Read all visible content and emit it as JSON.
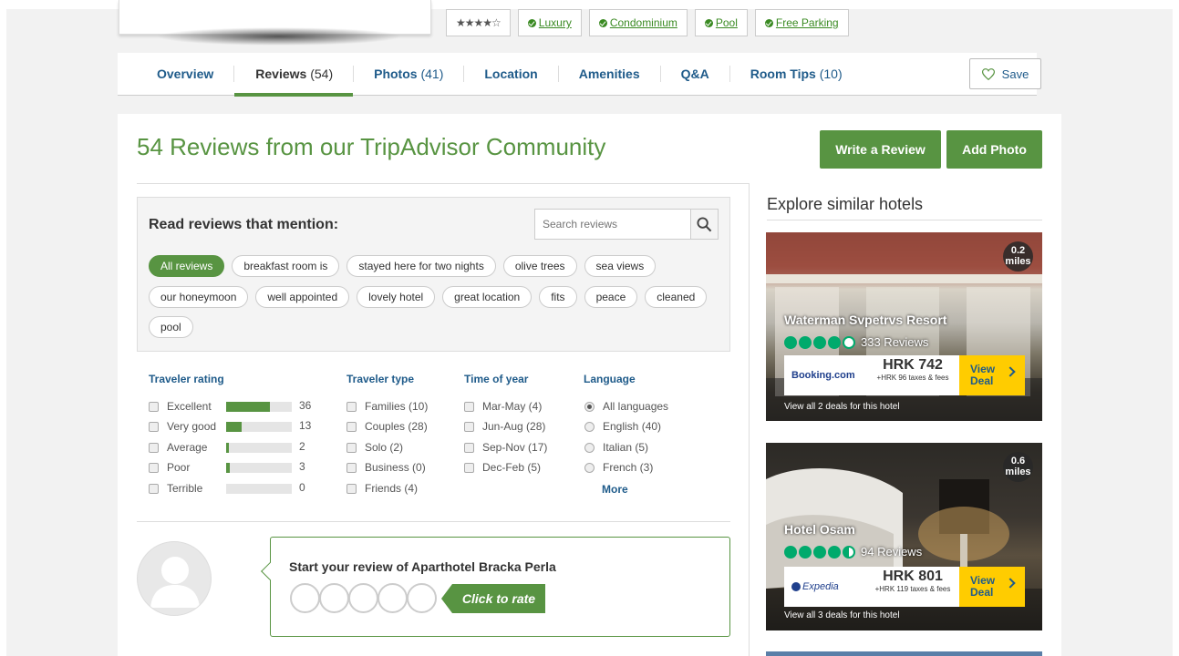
{
  "top": {
    "stars": "★★★★☆",
    "chips": [
      "Luxury",
      "Condominium",
      "Pool",
      "Free Parking"
    ]
  },
  "nav": {
    "tabs": [
      {
        "label": "Overview",
        "count": ""
      },
      {
        "label": "Reviews",
        "count": "(54)"
      },
      {
        "label": "Photos",
        "count": "(41)"
      },
      {
        "label": "Location",
        "count": ""
      },
      {
        "label": "Amenities",
        "count": ""
      },
      {
        "label": "Q&A",
        "count": ""
      },
      {
        "label": "Room Tips",
        "count": "(10)"
      }
    ],
    "save_label": "Save"
  },
  "reviews": {
    "title": "54 Reviews from our TripAdvisor Community",
    "write_review": "Write a Review",
    "add_photo": "Add Photo",
    "mentions_title": "Read reviews that mention:",
    "search_placeholder": "Search reviews",
    "tags_row1": [
      "All reviews",
      "breakfast room is",
      "stayed here for two nights",
      "olive trees",
      "sea views"
    ],
    "tags_row2": [
      "our honeymoon",
      "well appointed",
      "lovely hotel",
      "great location",
      "fits",
      "peace",
      "cleaned"
    ],
    "tags_row3": [
      "pool"
    ]
  },
  "filters": {
    "rating_title": "Traveler rating",
    "ratings": [
      {
        "label": "Excellent",
        "count": "36",
        "fraction": 0.67
      },
      {
        "label": "Very good",
        "count": "13",
        "fraction": 0.24
      },
      {
        "label": "Average",
        "count": "2",
        "fraction": 0.04
      },
      {
        "label": "Poor",
        "count": "3",
        "fraction": 0.06
      },
      {
        "label": "Terrible",
        "count": "0",
        "fraction": 0
      }
    ],
    "type_title": "Traveler type",
    "types": [
      "Families (10)",
      "Couples (28)",
      "Solo (2)",
      "Business (0)",
      "Friends (4)"
    ],
    "time_title": "Time of year",
    "times": [
      "Mar-May (4)",
      "Jun-Aug (28)",
      "Sep-Nov (17)",
      "Dec-Feb (5)"
    ],
    "lang_title": "Language",
    "languages": [
      "All languages",
      "English (40)",
      "Italian (5)",
      "French (3)"
    ],
    "more": "More"
  },
  "start_review": {
    "title": "Start your review of Aparthotel Bracka Perla",
    "click_to_rate": "Click to rate"
  },
  "sidebar": {
    "title": "Explore similar hotels",
    "hotels": [
      {
        "distance_num": "0.2",
        "distance_unit": "miles",
        "name": "Waterman Svpetrvs Resort",
        "rating": 4.5,
        "reviews": "333 Reviews",
        "provider": "Booking.com",
        "price": "HRK 742",
        "taxes": "+HRK 96 taxes & fees",
        "view_deal": "View Deal",
        "all_deals": "View all 2 deals for this hotel"
      },
      {
        "distance_num": "0.6",
        "distance_unit": "miles",
        "name": "Hotel Osam",
        "rating": 4.5,
        "reviews": "94 Reviews",
        "provider": "Expedia",
        "price": "HRK 801",
        "taxes": "+HRK 119 taxes & fees",
        "view_deal": "View Deal",
        "all_deals": "View all 3 deals for this hotel"
      }
    ]
  },
  "colors": {
    "accent": "#589442",
    "link": "#1f5b8a",
    "deal": "#ffcc00"
  }
}
